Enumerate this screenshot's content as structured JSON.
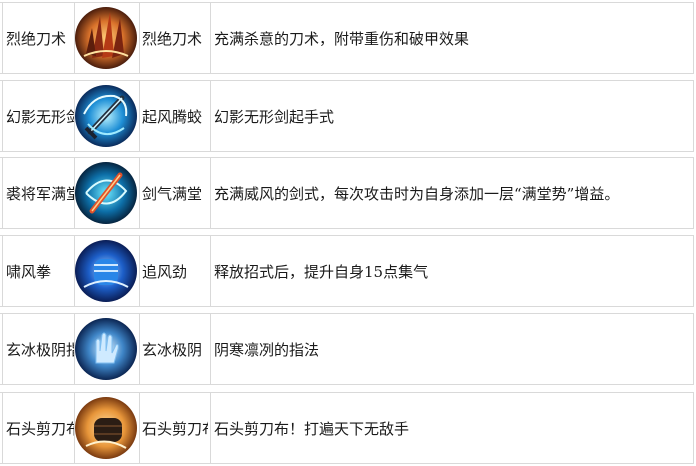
{
  "skills": [
    {
      "name": "烈绝刀术",
      "icon": "blade-strike-icon",
      "move": "烈绝刀术",
      "desc": "充满杀意的刀术，附带重伤和破甲效果"
    },
    {
      "name": "幻影无形剑",
      "icon": "phantom-sword-icon",
      "move": "起风腾蛟",
      "desc": "幻影无形剑起手式"
    },
    {
      "name": "裘将军满堂",
      "icon": "flaming-sword-icon",
      "move": "剑气满堂",
      "desc": "充满威风的剑式，每次攻击时为自身添加一层“满堂势”增益。"
    },
    {
      "name": "啸风拳",
      "icon": "wind-fist-icon",
      "move": "追风劲",
      "desc": "释放招式后，提升自身15点集气"
    },
    {
      "name": "玄冰极阴指",
      "icon": "ice-palm-icon",
      "move": "玄冰极阴",
      "desc": "阴寒凛冽的指法"
    },
    {
      "name": "石头剪刀布",
      "icon": "rock-fist-icon",
      "move": "石头剪刀布",
      "desc": "石头剪刀布！打遍天下无敌手"
    }
  ]
}
